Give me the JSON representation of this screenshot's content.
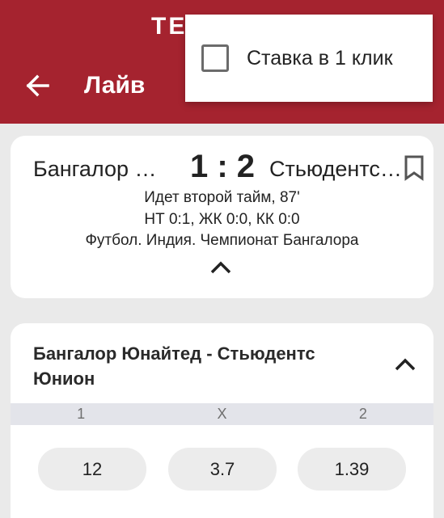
{
  "header": {
    "brand": "TE",
    "title": "Лайв"
  },
  "popup": {
    "one_click_label": "Ставка в 1 клик",
    "checked": false
  },
  "match": {
    "home_team": "Бангалор Юнайтед",
    "away_team": "Стьюдентс Юнион",
    "score": "1 : 2",
    "status": "Идет второй тайм, 87'",
    "stats": "НТ 0:1, ЖК 0:0, КК 0:0",
    "tournament": "Футбол. Индия. Чемпионат Бангалора"
  },
  "market": {
    "title": "Бангалор Юнайтед - Стьюдентс Юнион",
    "columns": [
      "1",
      "X",
      "2"
    ],
    "odds": [
      "12",
      "3.7",
      "1.39"
    ]
  },
  "colors": {
    "appbar": "#a5232f",
    "background": "#eaeaea"
  }
}
